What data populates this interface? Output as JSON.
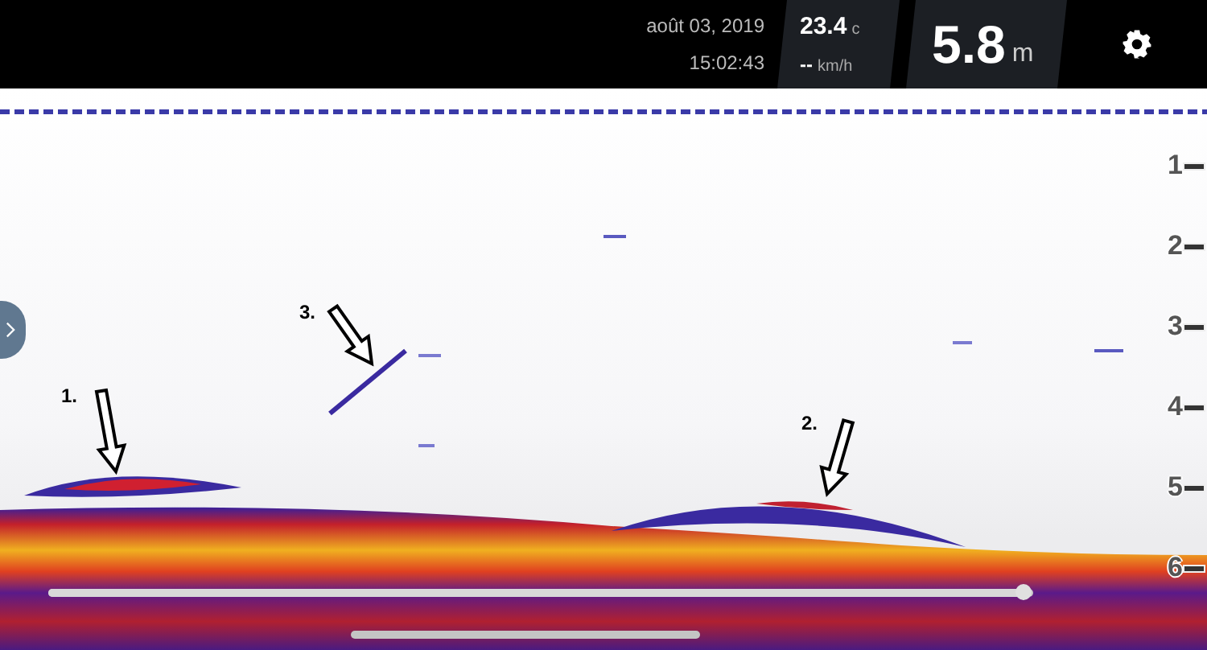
{
  "header": {
    "date": "août 03, 2019",
    "time": "15:02:43",
    "temperature": "23.4",
    "temperature_unit": "c",
    "speed": "--",
    "speed_unit": "km/h",
    "depth": "5.8",
    "depth_unit": "m"
  },
  "depth_scale": [
    "1",
    "2",
    "3",
    "4",
    "5",
    "6"
  ],
  "annotations": [
    {
      "label": "1."
    },
    {
      "label": "2."
    },
    {
      "label": "3."
    }
  ],
  "playback": {
    "level": 0.99
  }
}
